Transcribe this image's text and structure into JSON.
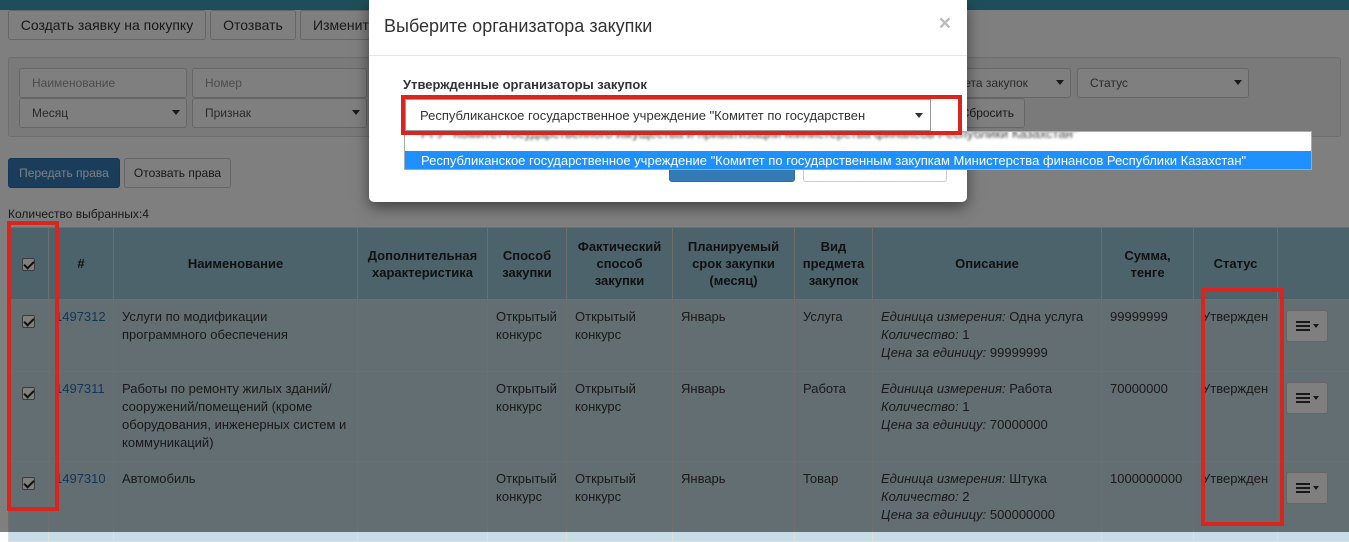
{
  "toolbar": {
    "create_label": "Создать заявку на покупку",
    "recall_label": "Отозвать",
    "change_label": "Изменит"
  },
  "filters": {
    "name_placeholder": "Наименование",
    "number_placeholder": "Номер",
    "month": "Месяц",
    "sign": "Признак",
    "subject_type": "мета закупок",
    "status": "Статус",
    "reset_label": "Сбросить"
  },
  "rights": {
    "transfer_label": "Передать права",
    "revoke_label": "Отозвать права"
  },
  "selected_count": "Количество выбранных:4",
  "table": {
    "headers": [
      "#",
      "Наименование",
      "Дополнительная характеристика",
      "Способ закупки",
      "Фактический способ закупки",
      "Планируемый срок закупки (месяц)",
      "Вид предмета закупок",
      "Описание",
      "Сумма, тенге",
      "Статус"
    ],
    "rows": [
      {
        "num": "1497312",
        "name": "Услуги по модификации программного обеспечения",
        "extra": "",
        "method": "Открытый конкурс",
        "actual_method": "Открытый конкурс",
        "month": "Январь",
        "subject": "Услуга",
        "unit_label": "Единица измерения:",
        "unit": "Одна услуга",
        "qty_label": "Количество:",
        "qty": "1",
        "price_label": "Цена за единицу:",
        "price": "99999999",
        "sum": "99999999",
        "status": "Утвержден"
      },
      {
        "num": "1497311",
        "name": "Работы по ремонту жилых зданий/сооружений/помещений (кроме оборудования, инженерных систем и коммуникаций)",
        "extra": "",
        "method": "Открытый конкурс",
        "actual_method": "Открытый конкурс",
        "month": "Январь",
        "subject": "Работа",
        "unit_label": "Единица измерения:",
        "unit": "Работа",
        "qty_label": "Количество:",
        "qty": "1",
        "price_label": "Цена за единицу:",
        "price": "70000000",
        "sum": "70000000",
        "status": "Утвержден"
      },
      {
        "num": "1497310",
        "name": "Автомобиль",
        "extra": "",
        "method": "Открытый конкурс",
        "actual_method": "Открытый конкурс",
        "month": "Январь",
        "subject": "Товар",
        "unit_label": "Единица измерения:",
        "unit": "Штука",
        "qty_label": "Количество:",
        "qty": "2",
        "price_label": "Цена за единицу:",
        "price": "500000000",
        "sum": "1000000000",
        "status": "Утвержден"
      }
    ]
  },
  "modal": {
    "title": "Выберите организатора закупки",
    "close_symbol": "×",
    "field_label": "Утвержденные организаторы закупок",
    "selected_value": "Республиканское государственное учреждение \"Комитет по государствен",
    "option_partial": "РГУ \"Комитет государственного имущества и приватизации Министерства финансов Республики Казахстан\"",
    "option_highlighted": "Республиканское государственное учреждение \"Комитет по государственным закупкам Министерства финансов Республики Казахстан\""
  },
  "colors": {
    "header_bg": "#9bc6d6",
    "row_bg": "#c6dde6",
    "primary": "#337ab7",
    "highlight": "#1e90ff",
    "annotation": "#d9251d"
  }
}
